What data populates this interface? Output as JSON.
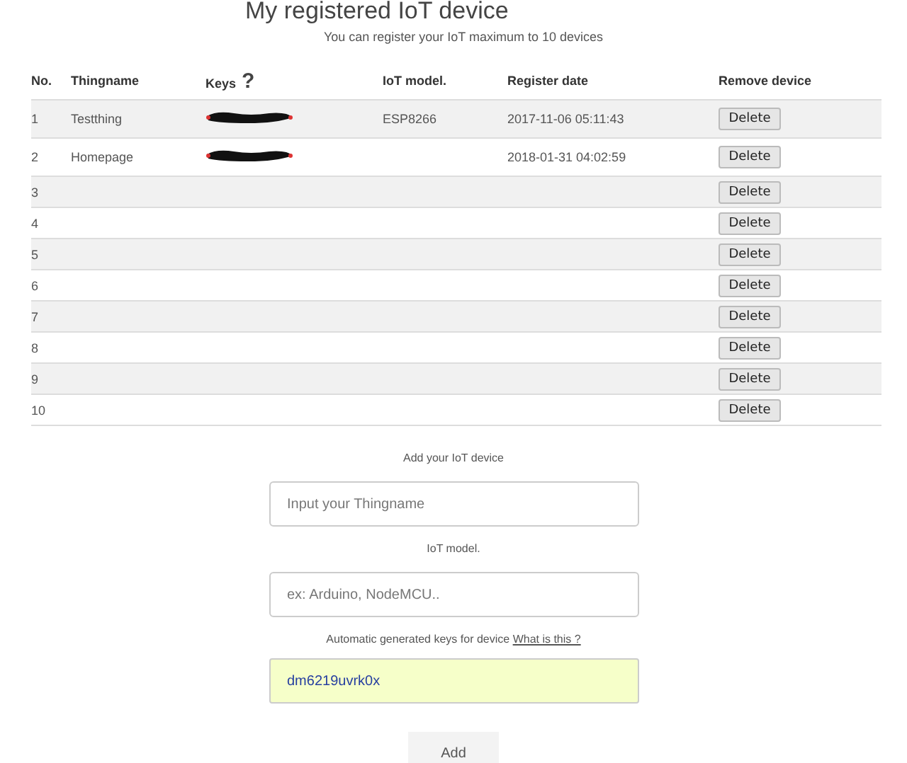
{
  "title": "My registered IoT device",
  "subtitle": "You can register your IoT maximum to 10 devices",
  "table": {
    "columns": [
      "No.",
      "Thingname",
      "Keys",
      "IoT model.",
      "Register date",
      "Remove device"
    ],
    "keys_help": "?",
    "rows": [
      {
        "no": "1",
        "thingname": "Testthing",
        "keys_redacted": true,
        "model": "ESP8266",
        "date": "2017-11-06 05:11:43",
        "action": "Delete"
      },
      {
        "no": "2",
        "thingname": "Homepage",
        "keys_redacted": true,
        "model": "",
        "date": "2018-01-31 04:02:59",
        "action": "Delete"
      },
      {
        "no": "3",
        "action": "Delete"
      },
      {
        "no": "4",
        "action": "Delete"
      },
      {
        "no": "5",
        "action": "Delete"
      },
      {
        "no": "6",
        "action": "Delete"
      },
      {
        "no": "7",
        "action": "Delete"
      },
      {
        "no": "8",
        "action": "Delete"
      },
      {
        "no": "9",
        "action": "Delete"
      },
      {
        "no": "10",
        "action": "Delete"
      }
    ]
  },
  "form": {
    "heading": "Add your IoT device",
    "thingname": {
      "placeholder": "Input your Thingname"
    },
    "model_label": "IoT model.",
    "model": {
      "placeholder": "ex: Arduino, NodeMCU.."
    },
    "keys_label": "Automatic generated keys for device",
    "keys_link": "What is this ?",
    "key_value": "dm6219uvrk0x",
    "submit": "Add"
  }
}
